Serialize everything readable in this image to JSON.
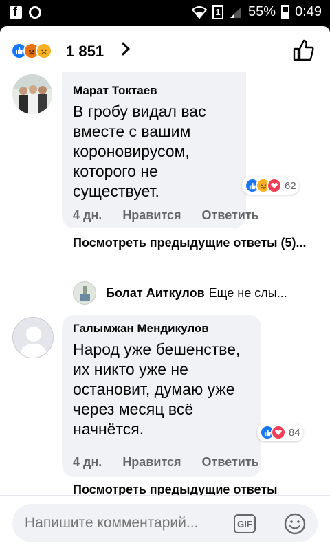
{
  "status_bar": {
    "battery": "55%",
    "time": "0:49",
    "sim": "1"
  },
  "header": {
    "reaction_count": "1 851"
  },
  "comments": [
    {
      "author": "Марат Токтаев",
      "text": "В гробу видал вас вместе с вашим короновирусом, которого не существует.",
      "reactions_count": "62",
      "time": "4 дн.",
      "like_label": "Нравится",
      "reply_label": "Ответить",
      "prev_replies": "Посмотреть предыдущие ответы (5)...",
      "reply": {
        "author": "Болат Аиткулов",
        "text": "Еще не слы..."
      }
    },
    {
      "author": "Галымжан Мендикулов",
      "text": "Народ уже бешенстве, их никто уже не остановит, думаю уже через месяц всё начнётся.",
      "reactions_count": "84",
      "time": "4 дн.",
      "like_label": "Нравится",
      "reply_label": "Ответить",
      "prev_replies": "Посмотреть предыдущие ответы"
    }
  ],
  "composer": {
    "placeholder": "Напишите комментарий...",
    "gif_label": "GIF"
  },
  "colors": {
    "accent": "#1877f2",
    "love": "#f33e58",
    "bubble": "#f0f2f5"
  }
}
